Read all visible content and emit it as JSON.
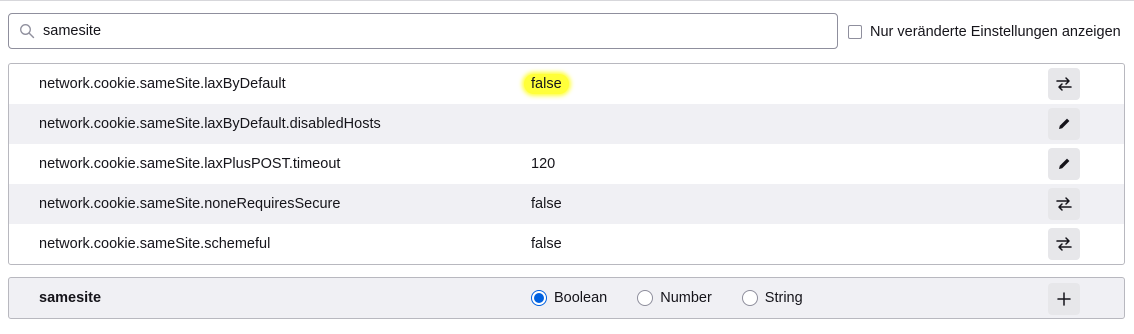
{
  "search": {
    "value": "samesite",
    "icon": "search-icon"
  },
  "filter": {
    "label": "Nur veränderte Einstellungen anzeigen",
    "checked": false
  },
  "prefs": [
    {
      "name": "network.cookie.sameSite.laxByDefault",
      "value": "false",
      "action": "toggle-icon",
      "highlighted": true
    },
    {
      "name": "network.cookie.sameSite.laxByDefault.disabledHosts",
      "value": "",
      "action": "edit-icon",
      "highlighted": false
    },
    {
      "name": "network.cookie.sameSite.laxPlusPOST.timeout",
      "value": "120",
      "action": "edit-icon",
      "highlighted": false
    },
    {
      "name": "network.cookie.sameSite.noneRequiresSecure",
      "value": "false",
      "action": "toggle-icon",
      "highlighted": false
    },
    {
      "name": "network.cookie.sameSite.schemeful",
      "value": "false",
      "action": "toggle-icon",
      "highlighted": false
    }
  ],
  "add_row": {
    "name": "samesite",
    "types": [
      {
        "label": "Boolean",
        "selected": true
      },
      {
        "label": "Number",
        "selected": false
      },
      {
        "label": "String",
        "selected": false
      }
    ],
    "action": "plus-icon"
  },
  "colors": {
    "highlight": "#ffff3a",
    "accent": "#0061e0",
    "row_alt": "#f0f0f4"
  }
}
